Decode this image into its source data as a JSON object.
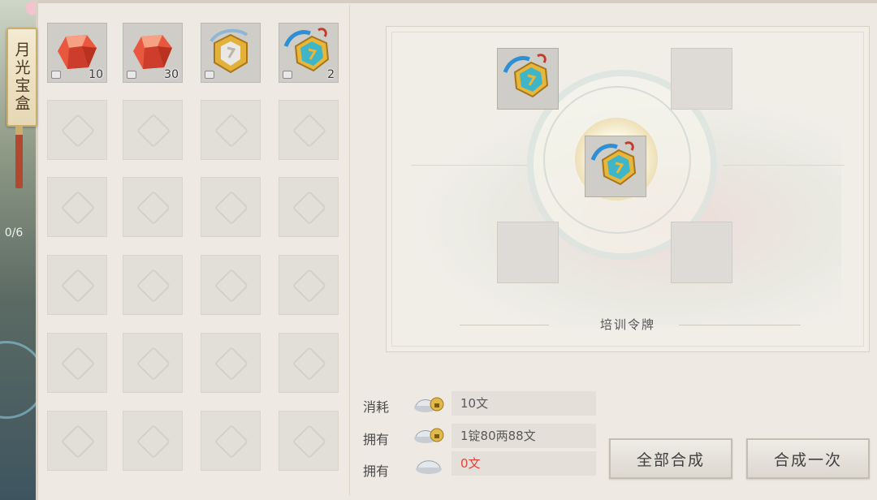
{
  "side_tab": {
    "label": "月光宝盒"
  },
  "world": {
    "counter": "0/6"
  },
  "inventory": {
    "items": [
      {
        "icon": "red-gem-icon",
        "qty": "10"
      },
      {
        "icon": "red-gem-icon",
        "qty": "30"
      },
      {
        "icon": "gold-medallion-icon",
        "qty": ""
      },
      {
        "icon": "training-token-icon",
        "qty": "2"
      }
    ],
    "total_slots": 24
  },
  "synthesis": {
    "target_name": "培训令牌",
    "input_slots": [
      {
        "icon": "training-token-icon",
        "filled": true
      },
      {
        "icon": "",
        "filled": false
      },
      {
        "icon": "",
        "filled": false
      },
      {
        "icon": "",
        "filled": false
      }
    ],
    "result": {
      "icon": "training-token-icon"
    }
  },
  "costs": {
    "consume": {
      "label": "消耗",
      "icon": "bound-silver-ingot-icon",
      "value": "10文"
    },
    "own_bound": {
      "label": "拥有",
      "icon": "bound-silver-ingot-icon",
      "value": "1锭80两88文"
    },
    "own": {
      "label": "拥有",
      "icon": "silver-ingot-icon",
      "value": "0文"
    }
  },
  "buttons": {
    "synthesize_all": "全部合成",
    "synthesize_once": "合成一次"
  },
  "colors": {
    "panel_bg": "#eeeae3",
    "insufficient_red": "#e0413a",
    "gold_trim": "#c9ae6c"
  }
}
